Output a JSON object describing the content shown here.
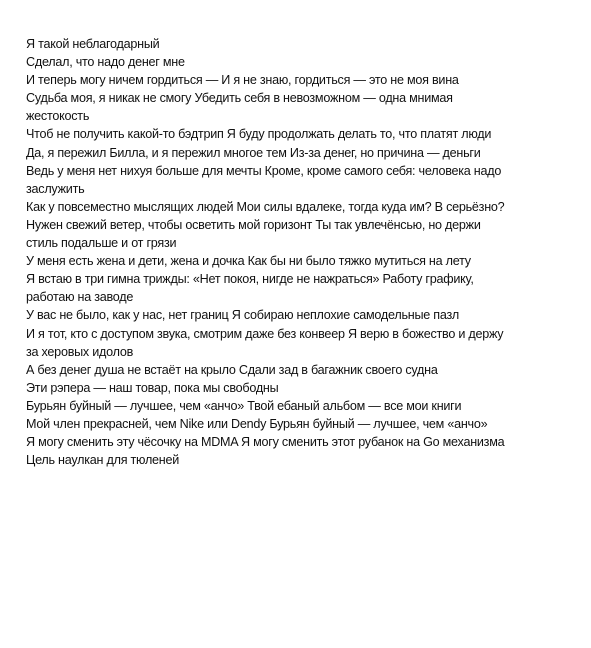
{
  "document": {
    "lines": [
      "Я такой неблагодарный",
      "Сделал, что надо денег мне",
      "И теперь могу ничем гордиться — И я не знаю, гордиться — это не моя вина",
      "Судьба моя, я никак не смогу Убедить себя в невозможном — одна мнимая",
      "жестокость",
      "Чтоб не получить какой-то бэдтрип Я буду продолжать делать то, что платят люди",
      "Да, я пережил Билла, и я пережил многое тем Из-за денег, но причина — деньги",
      "Ведь у меня нет нихуя больше для мечты Кроме, кроме самого себя: человека надо",
      "заслужить",
      "Как у повсеместно мыслящих людей Мои силы вдалеке, тогда куда им? В серьёзно?",
      "Нужен свежий ветер, чтобы осветить мой горизонт Ты так увлечёнсью, но держи",
      "стиль подальше и от грязи",
      "У меня есть жена и дети, жена и дочка Как бы ни было тяжко мутиться на лету",
      "Я встаю в три гимна трижды: «Нет покоя, нигде не нажраться» Работу графику,",
      "работаю на заводе",
      "У вас не было, как у нас, нет границ Я собираю неплохие самодельные пазл",
      "И я тот, кто с доступом звука, смотрим даже без конвеер Я верю в божество и держу",
      "за херовых идолов",
      "А без денег душа не встаёт на крыло Сдали зад в багажник своего судна",
      "Эти рэпера — наш товар, пока мы свободны",
      "Бурьян буйный — лучшее, чем «анчо» Твой ебаный альбом — все мои книги",
      "Мой член прекрасней, чем Nike или Dendy Бурьян буйный — лучшее, чем «анчо»",
      "Я могу сменить эту чёсочку на MDMA Я могу сменить этот рубанок на Go механизма",
      "Цель наулкан для тюленей"
    ]
  }
}
